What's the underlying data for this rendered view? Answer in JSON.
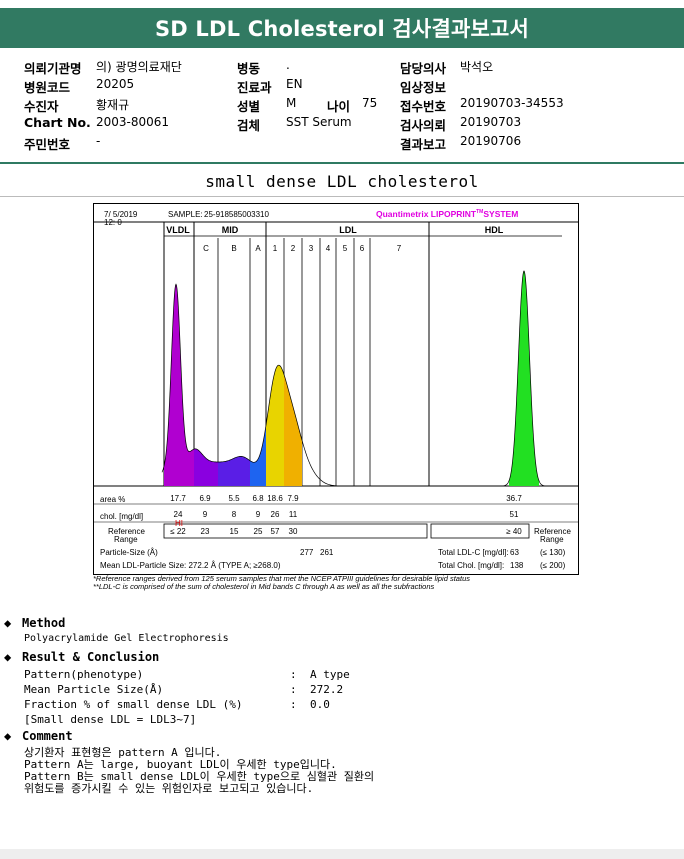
{
  "title": "SD LDL Cholesterol 검사결과보고서",
  "info": {
    "hospital_label": "의뢰기관명",
    "hospital_value": "의) 광명의료재단",
    "code_label": "병원코드",
    "code_value": "20205",
    "patient_label": "수진자",
    "patient_value": "황재규",
    "chart_label": "Chart No.",
    "chart_value": "2003-80061",
    "id_label": "주민번호",
    "id_value": "-",
    "ward_label": "병동",
    "ward_value": ".",
    "dept_label": "진료과",
    "dept_value": "EN",
    "sex_label": "성별",
    "sex_value": "M",
    "age_label": "나이",
    "age_value": "75",
    "specimen_label": "검체",
    "specimen_value": "SST Serum",
    "doctor_label": "담당의사",
    "doctor_value": "박석오",
    "clinical_label": "임상정보",
    "clinical_value": "",
    "receipt_label": "접수번호",
    "receipt_value": "20190703-34553",
    "request_label": "검사의뢰",
    "request_value": "20190703",
    "report_label": "결과보고",
    "report_value": "20190706"
  },
  "subtitle": "small dense LDL cholesterol",
  "report": {
    "date": "7/ 5/2019",
    "time": "12: 0",
    "sample_label": "SAMPLE:",
    "sample_value": "25-918585003310",
    "brand": "Quantimetrix LIPOPRINT",
    "brand_tm": "TM",
    "brand_suffix": "SYSTEM",
    "groups": [
      "VLDL",
      "MID",
      "LDL",
      "HDL"
    ],
    "bands": [
      "C",
      "B",
      "A",
      "1",
      "2",
      "3",
      "4",
      "5",
      "6",
      "7"
    ],
    "row_area_label": "area %",
    "row_chol_label": "chol. [mg/dl]",
    "row_ref_label1": "Reference",
    "row_ref_label2": "Range",
    "area_values": [
      "17.7",
      "6.9",
      "5.5",
      "6.8",
      "18.6",
      "7.9",
      "36.7"
    ],
    "chol_values": [
      "24",
      "9",
      "8",
      "9",
      "26",
      "11",
      "51"
    ],
    "hi_flag": "HI",
    "ref_values": [
      "≤ 22",
      "23",
      "15",
      "25",
      "57",
      "30",
      "≥ 40"
    ],
    "ref_right1": "Reference",
    "ref_right2": "Range",
    "particle_size_label": "Particle-Size (Å)",
    "particle_size_values": [
      "277",
      "261"
    ],
    "mean_size_text": "Mean LDL-Particle Size:   272.2 Å   (TYPE A; ≥268.0)",
    "total_ldl_label": "Total LDL-C [mg/dl]:",
    "total_ldl_value": "63",
    "total_ldl_ref": "(≤ 130)",
    "total_chol_label": "Total Chol. [mg/dl]:",
    "total_chol_value": "138",
    "total_chol_ref": "(≤ 200)"
  },
  "footnotes": [
    "*Reference ranges derived from 125 serum samples that met the NCEP ATPIII guidelines for desirable lipid status",
    "**LDL-C is comprised of the sum of cholesterol in Mid bands C through A as well as all the subfractions"
  ],
  "method": {
    "heading": "Method",
    "text": "Polyacrylamide Gel Electrophoresis"
  },
  "result": {
    "heading": "Result & Conclusion",
    "rows": [
      {
        "label": "Pattern(phenotype)",
        "sep": ":",
        "value": "A type"
      },
      {
        "label": "Mean Particle Size(Å)",
        "sep": ":",
        "value": "272.2"
      },
      {
        "label": "Fraction % of small dense LDL (%)",
        "sep": ":",
        "value": "0.0"
      }
    ],
    "note": "[Small dense LDL = LDL3~7]"
  },
  "comment": {
    "heading": "Comment",
    "lines": [
      "상기환자 표현형은 pattern A 입니다.",
      "Pattern A는 large, buoyant LDL이 우세한 type입니다.",
      "Pattern B는 small dense LDL이 우세한 type으로 심혈관 질환의",
      "위험도를 증가시킬 수 있는 위험인자로 보고되고 있습니다."
    ]
  },
  "colors": {
    "header_bg": "#317a62",
    "vldl": "#b000d0",
    "midC": "#8a00e0",
    "midB": "#5a1ee6",
    "midA": "#1e64f0",
    "ldl1": "#e8d400",
    "ldl2": "#f0b000",
    "hdl": "#22e022",
    "brand": "#e000e0",
    "hi": "#e00000"
  }
}
